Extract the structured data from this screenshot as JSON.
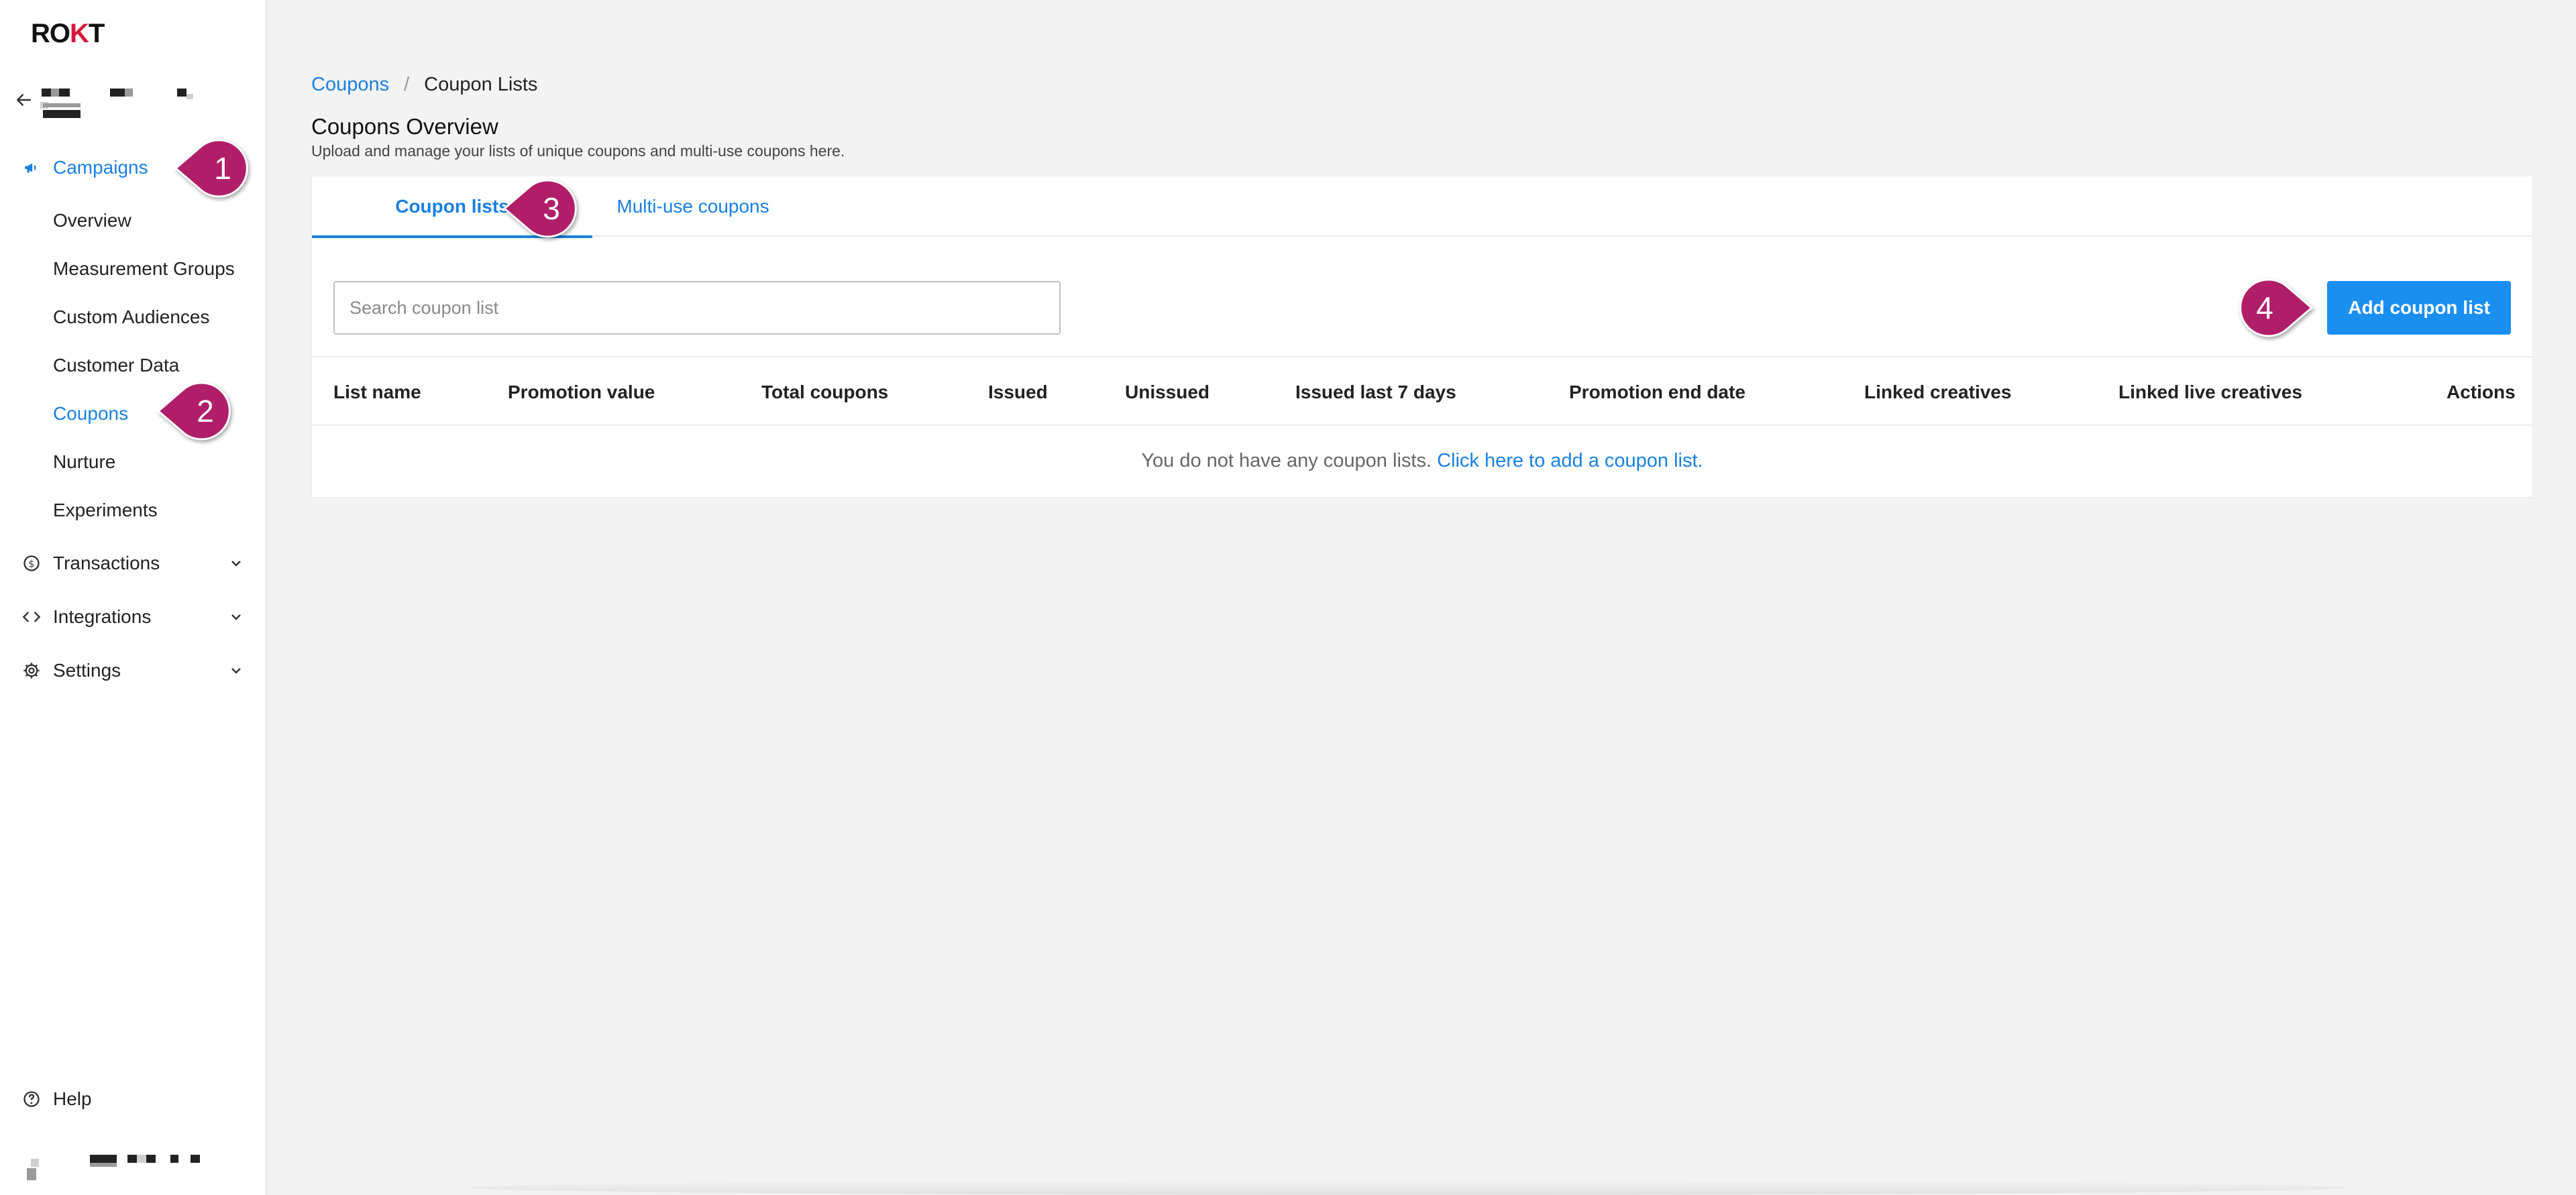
{
  "app": {
    "logo_text_pre": "RO",
    "logo_text_k": "K",
    "logo_text_post": "T"
  },
  "sidebar": {
    "campaigns_label": "Campaigns",
    "sub_items": [
      {
        "label": "Overview"
      },
      {
        "label": "Measurement Groups"
      },
      {
        "label": "Custom Audiences"
      },
      {
        "label": "Customer Data"
      },
      {
        "label": "Coupons"
      },
      {
        "label": "Nurture"
      },
      {
        "label": "Experiments"
      }
    ],
    "transactions_label": "Transactions",
    "integrations_label": "Integrations",
    "settings_label": "Settings",
    "help_label": "Help"
  },
  "breadcrumb": {
    "root": "Coupons",
    "separator": "/",
    "current": "Coupon Lists"
  },
  "page": {
    "title": "Coupons Overview",
    "subtitle": "Upload and manage your lists of unique coupons and multi-use coupons here."
  },
  "tabs": [
    {
      "label": "Coupon lists",
      "active": true
    },
    {
      "label": "Multi-use coupons",
      "active": false
    }
  ],
  "search": {
    "placeholder": "Search coupon list",
    "value": ""
  },
  "toolbar": {
    "add_label": "Add coupon list"
  },
  "table": {
    "columns": [
      "List name",
      "Promotion value",
      "Total coupons",
      "Issued",
      "Unissued",
      "Issued last 7 days",
      "Promotion end date",
      "Linked creatives",
      "Linked live creatives",
      "Actions"
    ],
    "empty_text": "You do not have any coupon lists.",
    "empty_link": "Click here to add a coupon list."
  },
  "callouts": [
    "1",
    "2",
    "3",
    "4"
  ],
  "colors": {
    "accent": "#1a80e0",
    "button": "#1b8ff0",
    "callout": "#b01e6a",
    "logo_k": "#d6173d"
  }
}
